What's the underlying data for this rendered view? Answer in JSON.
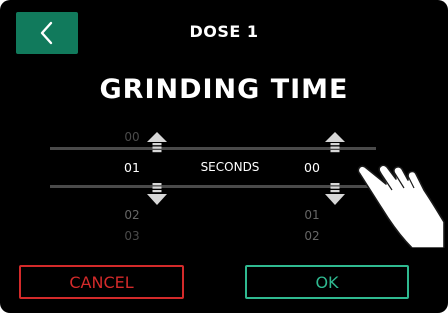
{
  "header": {
    "title": "DOSE 1",
    "back_icon": "chevron-left-icon"
  },
  "main": {
    "title": "GRINDING TIME"
  },
  "picker": {
    "unit_label": "SECONDS",
    "left_column": {
      "above": "00",
      "selected": "01",
      "below1": "02",
      "below2": "03"
    },
    "right_column": {
      "selected": "00",
      "below1": "01",
      "below2": "02"
    },
    "up_icon": "arrow-up-icon",
    "down_icon": "arrow-down-icon"
  },
  "actions": {
    "cancel_label": "CANCEL",
    "ok_label": "OK"
  },
  "colors": {
    "accent": "#117a5c",
    "cancel": "#d32a2a",
    "ok": "#2fb990"
  }
}
